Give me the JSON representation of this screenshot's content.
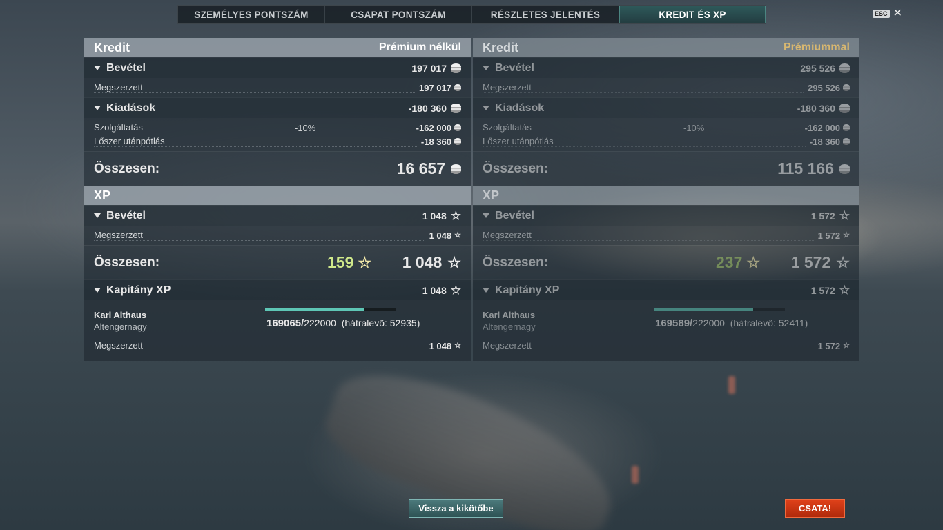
{
  "tabs": [
    "SZEMÉLYES PONTSZÁM",
    "CSAPAT PONTSZÁM",
    "RÉSZLETES JELENTÉS",
    "KREDIT ÉS XP"
  ],
  "esc_label": "ESC",
  "close_glyph": "✕",
  "icons": {
    "credit": "credit-coin-icon",
    "xp": "star-icon"
  },
  "colors": {
    "accent": "#5ec6b5",
    "premium_gold": "#d8b770",
    "battle": "#c7330f",
    "bonus_green": "#cfe88a"
  },
  "left": {
    "credit_title": "Kredit",
    "credit_mode": "Prémium nélkül",
    "income_label": "Bevétel",
    "income_value": "197 017",
    "earned_label": "Megszerzett",
    "earned_value": "197 017",
    "expenses_label": "Kiadások",
    "expenses_value": "-180 360",
    "service_label": "Szolgáltatás",
    "service_pct": "-10%",
    "service_value": "-162 000",
    "ammo_label": "Lőszer utánpótlás",
    "ammo_value": "-18 360",
    "total_label": "Összesen:",
    "total_value": "16 657",
    "xp_title": "XP",
    "xp_income_label": "Bevétel",
    "xp_income_value": "1 048",
    "xp_earned_label": "Megszerzett",
    "xp_earned_value": "1 048",
    "xp_total_label": "Összesen:",
    "xp_bonus": "159",
    "xp_total_value": "1 048",
    "captain_label": "Kapitány XP",
    "captain_value": "1 048",
    "captain_name": "Karl Althaus",
    "captain_rank": "Altengernagy",
    "captain_progress_current": "169065/",
    "captain_progress_max": "222000",
    "captain_remaining": "(hátralevő: 52935)",
    "captain_progress_fraction": 0.76,
    "captain_earned_label": "Megszerzett",
    "captain_earned_value": "1 048"
  },
  "right": {
    "credit_title": "Kredit",
    "credit_mode": "Prémiummal",
    "income_label": "Bevétel",
    "income_value": "295 526",
    "earned_label": "Megszerzett",
    "earned_value": "295 526",
    "expenses_label": "Kiadások",
    "expenses_value": "-180 360",
    "service_label": "Szolgáltatás",
    "service_pct": "-10%",
    "service_value": "-162 000",
    "ammo_label": "Lőszer utánpótlás",
    "ammo_value": "-18 360",
    "total_label": "Összesen:",
    "total_value": "115 166",
    "xp_title": "XP",
    "xp_income_label": "Bevétel",
    "xp_income_value": "1 572",
    "xp_earned_label": "Megszerzett",
    "xp_earned_value": "1 572",
    "xp_total_label": "Összesen:",
    "xp_bonus": "237",
    "xp_total_value": "1 572",
    "captain_label": "Kapitány XP",
    "captain_value": "1 572",
    "captain_name": "Karl Althaus",
    "captain_rank": "Altengernagy",
    "captain_progress_current": "169589/",
    "captain_progress_max": "222000",
    "captain_remaining": "(hátralevő: 52411)",
    "captain_progress_fraction": 0.76,
    "captain_earned_label": "Megszerzett",
    "captain_earned_value": "1 572"
  },
  "buttons": {
    "back": "Vissza a kikötőbe",
    "battle": "CSATA!"
  }
}
